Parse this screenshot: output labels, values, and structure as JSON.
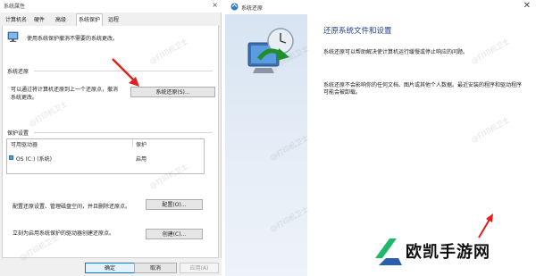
{
  "sysprop": {
    "title": "系统属性",
    "close_label": "×",
    "tabs": [
      {
        "label": "计算机名"
      },
      {
        "label": "硬件"
      },
      {
        "label": "高级"
      },
      {
        "label": "系统保护"
      },
      {
        "label": "远程"
      }
    ],
    "intro": "使用系统保护撤消不需要的系统更改。",
    "restore_section": "系统还原",
    "restore_desc_line1": "可以通过将计算机还原到上一个还原点，撤消",
    "restore_desc_line2": "系统更改。",
    "restore_button": "系统还原(S)...",
    "protection_section": "保护设置",
    "table": {
      "col_drive": "可用驱动器",
      "col_protect": "保护",
      "rows": [
        {
          "drive": "OS (C:) (系统)",
          "protect": "启用"
        }
      ]
    },
    "config_desc": "配置还原设置、管理磁盘空间，并且删除还原点。",
    "config_button": "配置(O)...",
    "create_desc": "立刻为启用系统保护的驱动器创建还原点。",
    "create_button": "创建(C)...",
    "ok": "确定",
    "cancel": "取消",
    "apply": "应用(A)"
  },
  "restore": {
    "title": "系统还原",
    "close_label": "✕",
    "heading": "还原系统文件和设置",
    "para1": "系统还原可以帮助解决使计算机运行缓慢或停止响应的问题。",
    "para2": "系统还原不会影响你的任何文档、图片或其他个人数据。最近安装的程序和驱动程序可能会被卸载。"
  },
  "watermark": "@打印机卫士",
  "brand": {
    "name": "欧凯手游网"
  },
  "colors": {
    "arrow": "#e02020",
    "brand_green": "#1fb86b",
    "brand_blue": "#2a5fb0",
    "heading": "#1e3f8f"
  }
}
